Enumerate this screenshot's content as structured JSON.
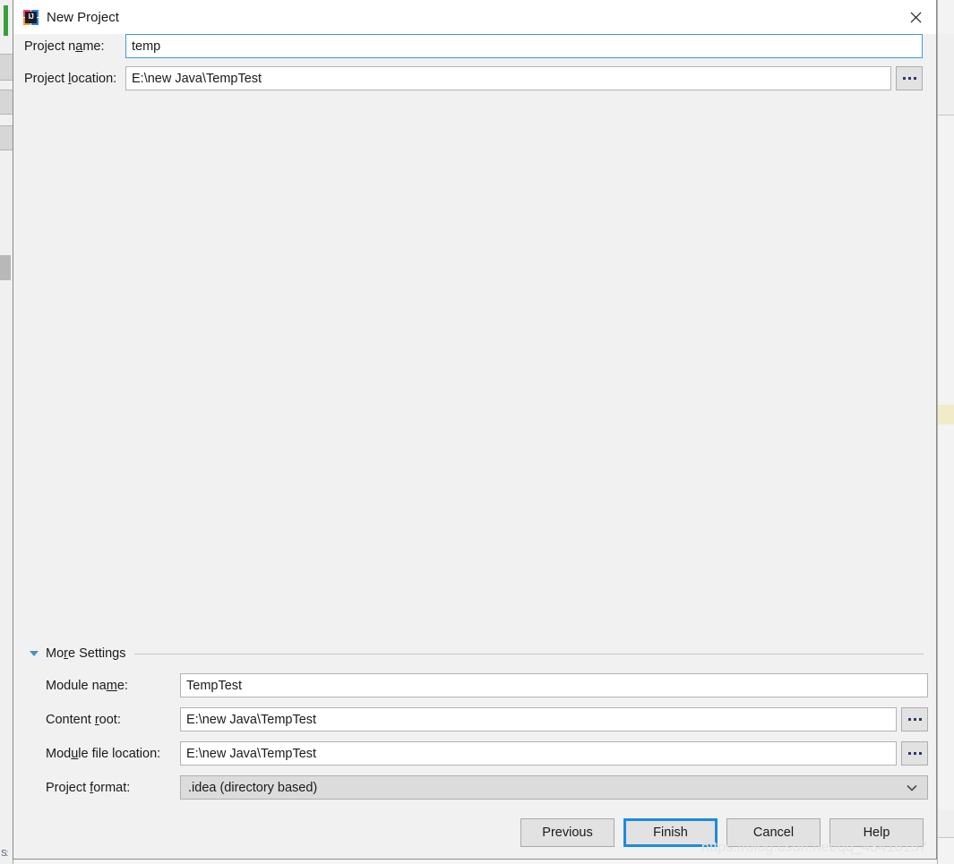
{
  "window": {
    "title": "New Project",
    "app_icon": "intellij-idea-icon",
    "icon_letters": "IJ",
    "close_icon": "close-icon"
  },
  "top_form": {
    "fields": [
      {
        "label_before": "Project n",
        "label_mnemonic": "a",
        "label_after": "me:",
        "value": "temp",
        "focused": true,
        "has_browse": false
      },
      {
        "label_before": "Project ",
        "label_mnemonic": "l",
        "label_after": "ocation:",
        "value": "E:\\new Java\\TempTest",
        "focused": false,
        "has_browse": true
      }
    ]
  },
  "more_settings": {
    "title_before": "Mo",
    "title_mnemonic": "r",
    "title_after": "e Settings",
    "expanded": true,
    "expand_icon": "triangle-down-icon",
    "fields": [
      {
        "label_before": "Module na",
        "label_mnemonic": "m",
        "label_after": "e:",
        "value": "TempTest",
        "type": "text",
        "has_browse": false
      },
      {
        "label_before": "Content ",
        "label_mnemonic": "r",
        "label_after": "oot:",
        "value": "E:\\new Java\\TempTest",
        "type": "text",
        "has_browse": true
      },
      {
        "label_before": "Mod",
        "label_mnemonic": "u",
        "label_after": "le file location:",
        "value": "E:\\new Java\\TempTest",
        "type": "text",
        "has_browse": true
      },
      {
        "label_before": "Project ",
        "label_mnemonic": "f",
        "label_after": "ormat:",
        "value": ".idea (directory based)",
        "type": "combo",
        "has_browse": false
      }
    ]
  },
  "footer": {
    "buttons": [
      {
        "label": "Previous",
        "default": false
      },
      {
        "label": "Finish",
        "default": true
      },
      {
        "label": "Cancel",
        "default": false
      },
      {
        "label": "Help",
        "default": false
      }
    ]
  },
  "watermark": "https://blog.csdn.net/qq_43416157",
  "background": {
    "bottom_left_text": "S:",
    "colors": {
      "accent_blue": "#1e8ae0",
      "focus_border": "#3f9ae0",
      "dialog_bg": "#f1f1f1",
      "titlebar_bg": "#ffffff",
      "button_bg": "#e2e2e2",
      "combo_bg": "#dcdcdc",
      "green_tab": "#38a038",
      "yellow_marker": "#f0ecc8"
    }
  }
}
